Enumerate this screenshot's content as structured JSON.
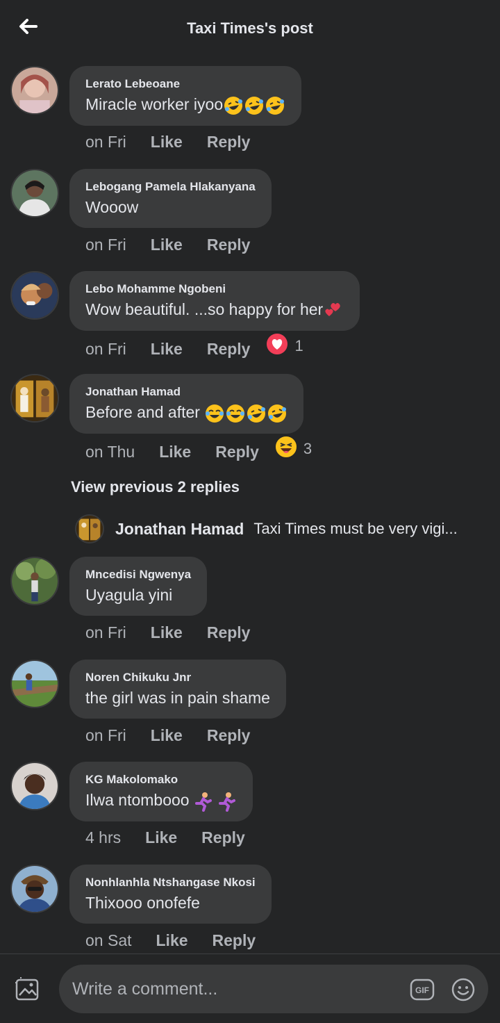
{
  "header": {
    "title": "Taxi Times's post"
  },
  "comments": [
    {
      "author": "Lerato Lebeoane",
      "text": "Miracle worker iyoo",
      "emoji": [
        "rofl",
        "rofl",
        "rofl"
      ],
      "time": "on Fri",
      "like": "Like",
      "reply": "Reply"
    },
    {
      "author": "Lebogang Pamela Hlakanyana",
      "text": "Wooow",
      "emoji": [],
      "time": "on Fri",
      "like": "Like",
      "reply": "Reply"
    },
    {
      "author": "Lebo Mohamme Ngobeni",
      "text": "Wow beautiful. ...so happy for her",
      "emoji": [
        "two-hearts"
      ],
      "time": "on Fri",
      "like": "Like",
      "reply": "Reply",
      "reaction": {
        "icon": "love-reaction-icon",
        "count": "1"
      }
    },
    {
      "author": "Jonathan Hamad",
      "text": "Before and after",
      "emoji": [
        "joy",
        "joy",
        "rofl",
        "rofl"
      ],
      "time": "on Thu",
      "like": "Like",
      "reply": "Reply",
      "reaction": {
        "icon": "haha-reaction-icon",
        "count": "3"
      }
    },
    {
      "author": "Mncedisi Ngwenya",
      "text": "Uyagula yini",
      "emoji": [],
      "time": "on Fri",
      "like": "Like",
      "reply": "Reply"
    },
    {
      "author": "Noren Chikuku Jnr",
      "text": "the girl was in pain shame",
      "emoji": [],
      "time": "on Fri",
      "like": "Like",
      "reply": "Reply"
    },
    {
      "author": "KG Makolomako",
      "text": "Ilwa ntombooo",
      "emoji": [
        "runner",
        "runner"
      ],
      "time": "4 hrs",
      "like": "Like",
      "reply": "Reply"
    },
    {
      "author": "Nonhlanhla Ntshangase Nkosi",
      "text": "Thixooo onofefe",
      "emoji": [],
      "time": "on Sat",
      "like": "Like",
      "reply": "Reply"
    }
  ],
  "view_previous": "View previous 2 replies",
  "reply_preview": {
    "author": "Jonathan Hamad",
    "text": "Taxi Times must be very vigi..."
  },
  "composer": {
    "placeholder": "Write a comment..."
  },
  "colors": {
    "background": "#242526",
    "bubble": "#3a3b3c",
    "text": "#e4e6eb",
    "muted": "#b0b3b8"
  }
}
